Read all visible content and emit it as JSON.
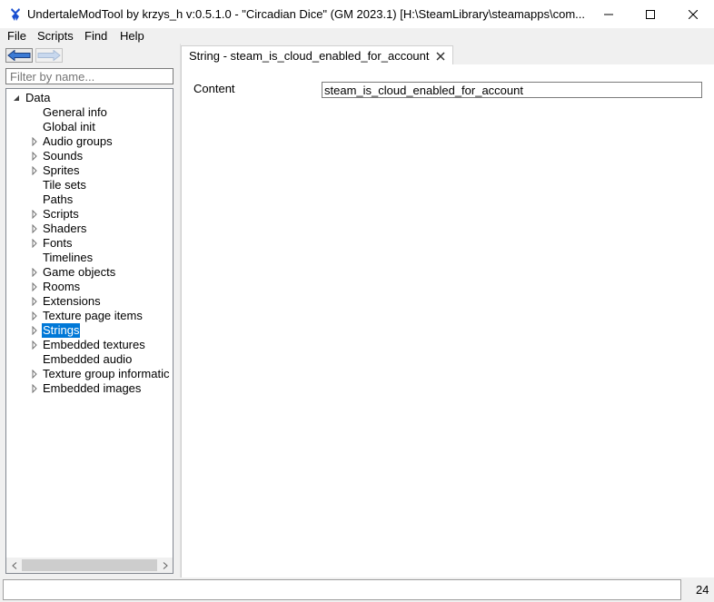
{
  "window": {
    "title": "UndertaleModTool by krzys_h v:0.5.1.0 - \"Circadian Dice\" (GM 2023.1) [H:\\SteamLibrary\\steamapps\\com..."
  },
  "menu": {
    "items": [
      "File",
      "Scripts",
      "Find",
      "Help"
    ]
  },
  "left": {
    "filter_placeholder": "Filter by name...",
    "tree_root": "Data",
    "tree_items": [
      {
        "label": "General info",
        "expandable": false
      },
      {
        "label": "Global init",
        "expandable": false
      },
      {
        "label": "Audio groups",
        "expandable": true
      },
      {
        "label": "Sounds",
        "expandable": true
      },
      {
        "label": "Sprites",
        "expandable": true
      },
      {
        "label": "Tile sets",
        "expandable": false
      },
      {
        "label": "Paths",
        "expandable": false
      },
      {
        "label": "Scripts",
        "expandable": true
      },
      {
        "label": "Shaders",
        "expandable": true
      },
      {
        "label": "Fonts",
        "expandable": true
      },
      {
        "label": "Timelines",
        "expandable": false
      },
      {
        "label": "Game objects",
        "expandable": true
      },
      {
        "label": "Rooms",
        "expandable": true
      },
      {
        "label": "Extensions",
        "expandable": true
      },
      {
        "label": "Texture page items",
        "expandable": true
      },
      {
        "label": "Strings",
        "expandable": true,
        "selected": true
      },
      {
        "label": "Embedded textures",
        "expandable": true
      },
      {
        "label": "Embedded audio",
        "expandable": false
      },
      {
        "label": "Texture group informatic",
        "expandable": true
      },
      {
        "label": "Embedded images",
        "expandable": true
      }
    ]
  },
  "tab": {
    "label": "String - steam_is_cloud_enabled_for_account"
  },
  "editor": {
    "content_label": "Content",
    "content_value": "steam_is_cloud_enabled_for_account"
  },
  "status": {
    "count": "24"
  },
  "colors": {
    "selection": "#0078d7",
    "nav_arrow": "#3c7ad4"
  }
}
